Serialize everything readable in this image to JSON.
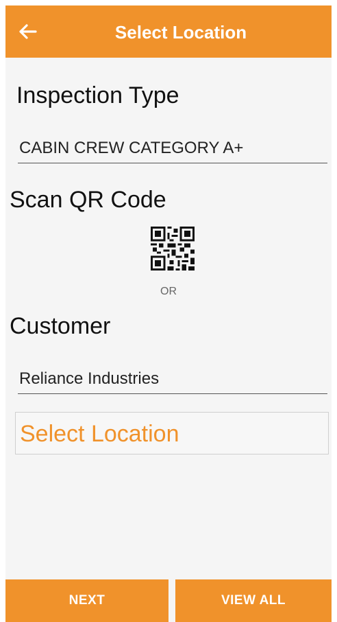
{
  "app_bar": {
    "back_icon": "arrow-left-icon",
    "title": "Select Location"
  },
  "inspection_type": {
    "label": "Inspection Type",
    "value": "CABIN CREW CATEGORY A+"
  },
  "scan": {
    "label": "Scan QR Code",
    "icon": "qr-code-icon",
    "or_text": "OR"
  },
  "customer": {
    "label": "Customer",
    "value": "Reliance Industries"
  },
  "location": {
    "placeholder": "Select Location"
  },
  "footer": {
    "next_label": "NEXT",
    "view_all_label": "VIEW ALL"
  },
  "colors": {
    "accent": "#f0922b",
    "background": "#f5f5f5",
    "text": "#111111"
  }
}
